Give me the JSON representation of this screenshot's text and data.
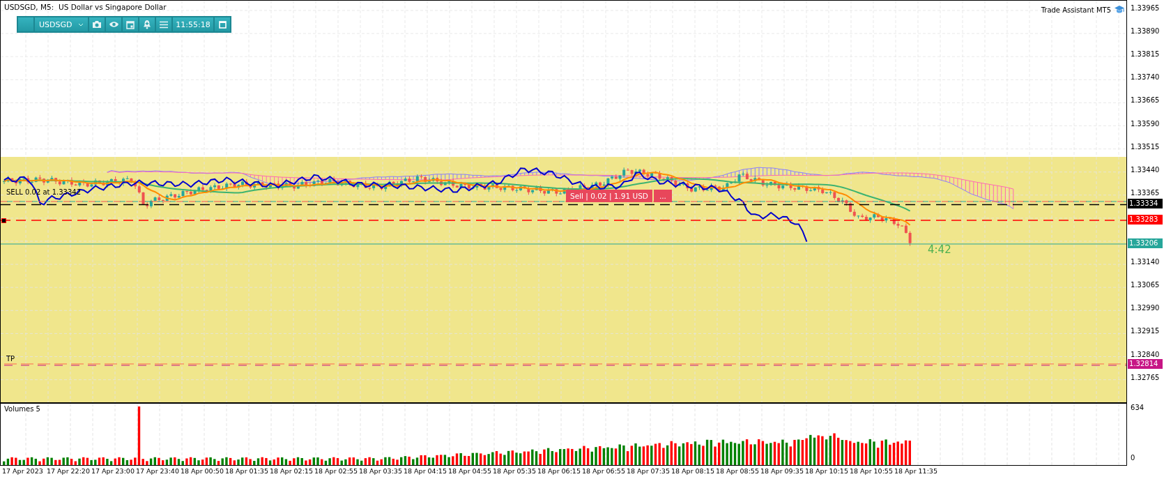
{
  "chart": {
    "title": "USDSGD, M5:  US Dollar vs Singapore Dollar",
    "indicator": "Trade Assistant MT5"
  },
  "toolbar": {
    "symbol": "USDSGD",
    "time": "11:55:18"
  },
  "price_axis": {
    "upper_ticks": [
      "1.33965",
      "1.33890",
      "1.33815",
      "1.33740",
      "1.33665",
      "1.33590",
      "1.33515",
      "1.33440",
      "1.33365"
    ],
    "lower_ticks": [
      "1.33140",
      "1.33065",
      "1.32990",
      "1.32915",
      "1.32840",
      "1.32765"
    ],
    "tags": [
      {
        "text": "1.33334",
        "kind": "bid"
      },
      {
        "text": "1.33283",
        "kind": "stop"
      },
      {
        "text": "1.33206",
        "kind": "current"
      },
      {
        "text": "1.32814",
        "kind": "take_profit"
      }
    ]
  },
  "order_lines": {
    "sell_label": "SELL 0.02 at 1.33342",
    "tp_label": "TP"
  },
  "position_button": {
    "text": "Sell | 0.02 | 1.91 USD",
    "more": "..."
  },
  "bar_timer": "4:42",
  "volumes": {
    "title": "Volumes 5",
    "max": "634",
    "min": "0"
  },
  "time_axis": [
    "17 Apr 2023",
    "17 Apr 22:20",
    "17 Apr 23:00",
    "17 Apr 23:40",
    "18 Apr 00:50",
    "18 Apr 01:35",
    "18 Apr 02:15",
    "18 Apr 02:55",
    "18 Apr 03:35",
    "18 Apr 04:15",
    "18 Apr 04:55",
    "18 Apr 05:35",
    "18 Apr 06:15",
    "18 Apr 06:55",
    "18 Apr 07:35",
    "18 Apr 08:15",
    "18 Apr 08:55",
    "18 Apr 09:35",
    "18 Apr 10:15",
    "18 Apr 10:55",
    "18 Apr 11:35"
  ]
}
